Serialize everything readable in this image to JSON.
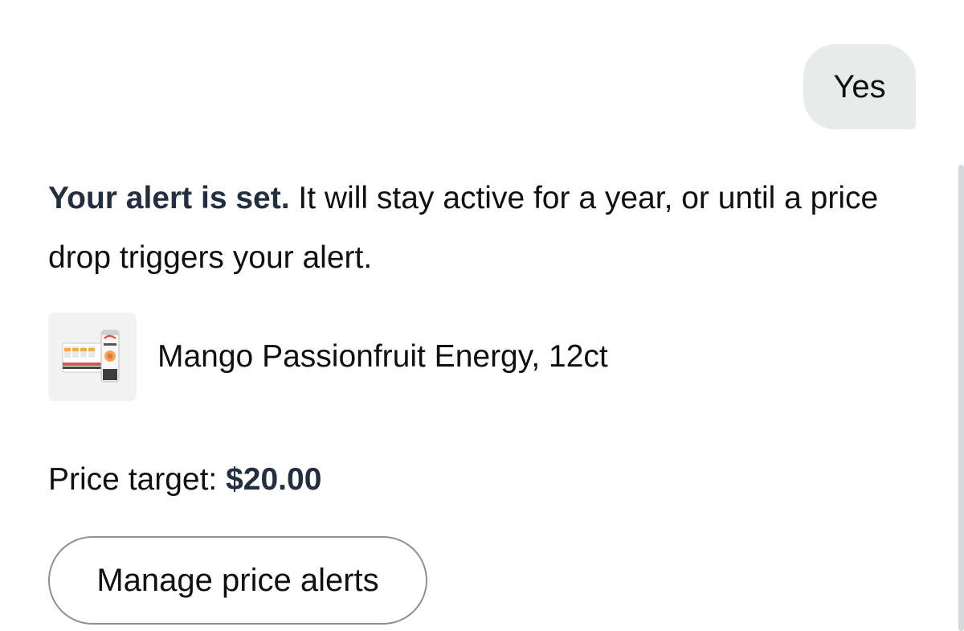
{
  "user_message": {
    "text": "Yes"
  },
  "assistant_reply": {
    "bold_text": "Your alert is set.",
    "text": " It will stay active for a year, or until a price drop triggers your alert."
  },
  "product": {
    "name": "Mango Passionfruit Energy, 12ct",
    "thumbnail_icon": "energy-drink-pack-image"
  },
  "price_target": {
    "label": "Price target: ",
    "value": "$20.00"
  },
  "actions": {
    "manage_label": "Manage price alerts"
  },
  "colors": {
    "user_bubble": "#e9ebeb",
    "text": "#0f1111",
    "emphasis": "#232f3e",
    "button_border": "#8d9096"
  }
}
